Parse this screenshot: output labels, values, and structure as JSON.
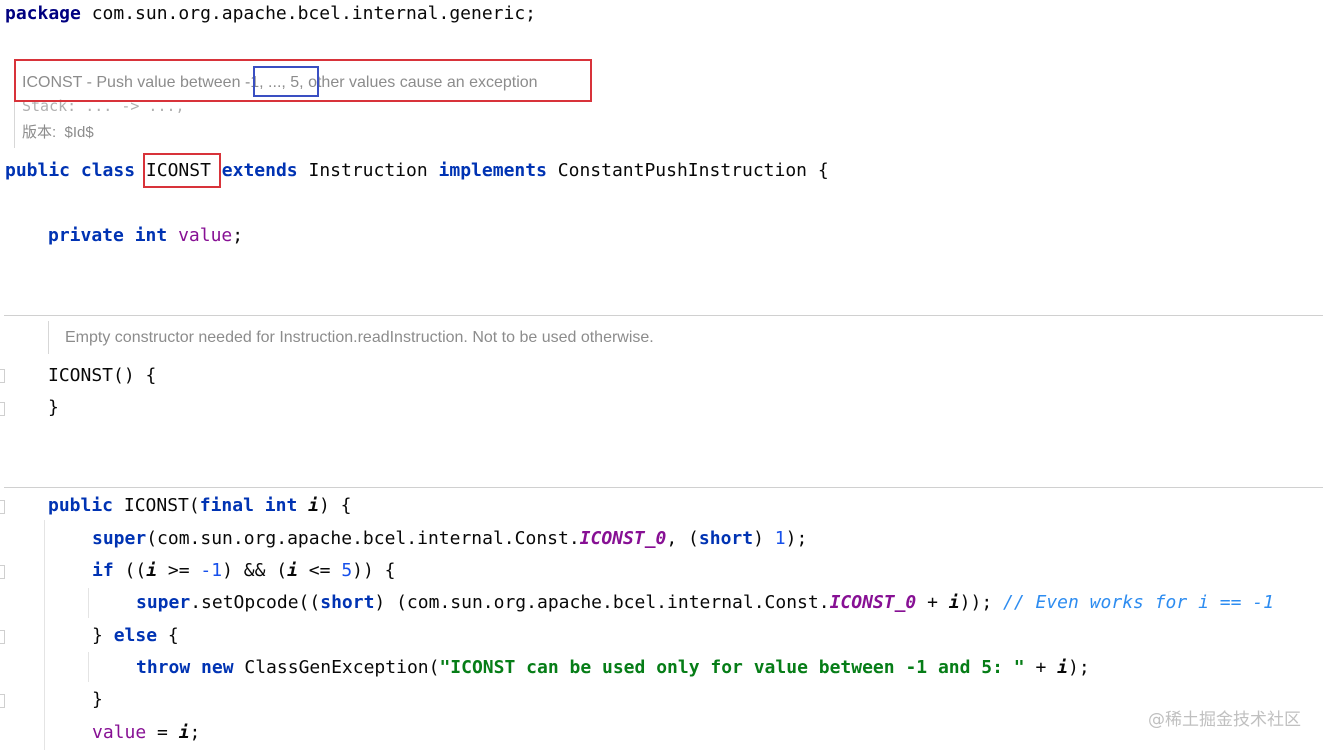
{
  "package_line": {
    "keyword": "package",
    "name": " com.sun.org.apache.bcel.internal.generic;"
  },
  "class_doc": {
    "line1_prefix": "ICONST - Push value between",
    "line1_range": "-1, ..., 5,",
    "line1_suffix": "other values cause an exception",
    "line2": "Stack: ... -> ...,",
    "line3": "版本:  $Id$"
  },
  "class_decl": {
    "public": "public",
    "class": "class",
    "name": "ICONST",
    "extends": "extends",
    "superclass": "Instruction",
    "implements": "implements",
    "interface": "ConstantPushInstruction",
    "brace": " {"
  },
  "field_decl": {
    "private": "private",
    "int": "int",
    "name": "value",
    "semi": ";"
  },
  "ctor_doc": "Empty constructor needed for Instruction.readInstruction. Not to be used otherwise.",
  "ctor_empty": {
    "open": "ICONST() {",
    "close": "}"
  },
  "ctor2": {
    "public": "public",
    "sig_name": " ICONST(",
    "final": "final",
    "int": "int",
    "param": "i",
    "sig_end": ") {",
    "super_kw": "super",
    "super_args_a": "(com.sun.org.apache.bcel.internal.Const.",
    "const_name": "ICONST_0",
    "super_args_b": ", (",
    "short_kw": "short",
    "super_args_c": ") ",
    "one": "1",
    "super_end": ");",
    "if_kw": "if",
    "if_a": " ((",
    "if_b": " >= ",
    "minus_one": "-1",
    "if_c": ") && (",
    "if_d": " <= ",
    "five": "5",
    "if_e": ")) {",
    "set_super": "super",
    "set_a": ".setOpcode((",
    "set_short": "short",
    "set_b": ") (com.sun.org.apache.bcel.internal.Const.",
    "set_const": "ICONST_0",
    "set_c": " + ",
    "set_d": ")); ",
    "comment": "// Even works for i == -1",
    "else_close": "} ",
    "else_kw": "else",
    "else_open": " {",
    "throw_kw": "throw",
    "new_kw": "new",
    "exc_a": " ClassGenException(",
    "exc_str": "\"ICONST can be used only for value between -1 and 5: \"",
    "exc_b": " + ",
    "exc_c": ");",
    "close_brace": "}",
    "assign_field": "value",
    "assign_a": " = ",
    "assign_b": ";"
  },
  "watermark": "@稀土掘金技术社区",
  "colors": {
    "keyword": "#0033b3",
    "field": "#871094",
    "number": "#1750eb",
    "string": "#067d17",
    "comment": "#2d8cf0",
    "highlight_red": "#d8333a",
    "highlight_blue": "#3a4fc2"
  }
}
